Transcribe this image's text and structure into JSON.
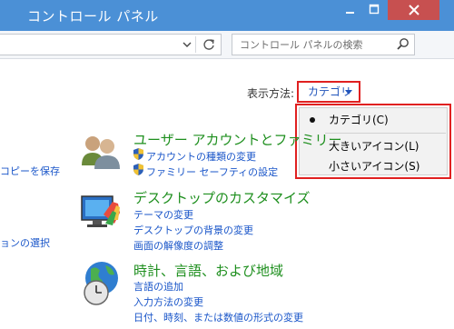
{
  "window": {
    "title": "コントロール パネル",
    "close_color": "#c75050",
    "titlebar_color": "#4b90d6"
  },
  "toolbar": {
    "search_placeholder": "コントロール パネルの検索"
  },
  "view": {
    "label": "表示方法:",
    "current": "カテゴリ",
    "menu": [
      {
        "label": "カテゴリ(C)",
        "selected": true
      },
      {
        "label": "大きいアイコン(L)",
        "selected": false
      },
      {
        "label": "小さいアイコン(S)",
        "selected": false
      }
    ],
    "highlight_color": "#e02020"
  },
  "left": {
    "link1": "コピーを保存",
    "link2": "ョンの選択"
  },
  "categories": [
    {
      "title": "ユーザー アカウントとファミリー",
      "links": [
        "アカウントの種類の変更",
        "ファミリー セーフティの設定"
      ]
    },
    {
      "title": "デスクトップのカスタマイズ",
      "links": [
        "テーマの変更",
        "デスクトップの背景の変更",
        "画面の解像度の調整"
      ]
    },
    {
      "title": "時計、言語、および地域",
      "links": [
        "言語の追加",
        "入力方法の変更",
        "日付、時刻、または数値の形式の変更"
      ]
    }
  ]
}
